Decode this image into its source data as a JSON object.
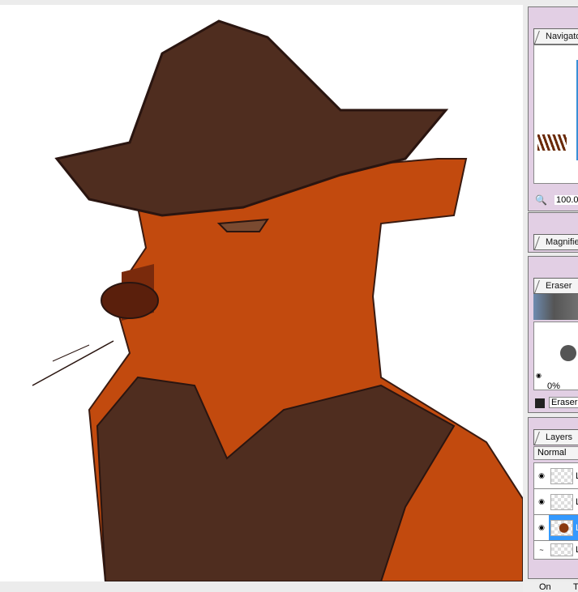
{
  "navigator": {
    "title": "Navigator",
    "zoom": "100.0"
  },
  "magnifier": {
    "title": "Magnifier"
  },
  "brush": {
    "title": "Eraser",
    "opacity": "0%",
    "tool_name": "Eraser"
  },
  "layers": {
    "title": "Layers",
    "blend_mode": "Normal",
    "items": [
      {
        "label": "L",
        "visible": true
      },
      {
        "label": "L",
        "visible": true
      },
      {
        "label": "L",
        "visible": true,
        "selected": true
      },
      {
        "label": "L",
        "visible": false
      }
    ]
  },
  "status": {
    "left": "On",
    "right": "T"
  },
  "colors": {
    "panel": "#e2cfe4",
    "selected": "#3399ff",
    "fur": "#c04a10",
    "hat": "#4a2a1a"
  }
}
